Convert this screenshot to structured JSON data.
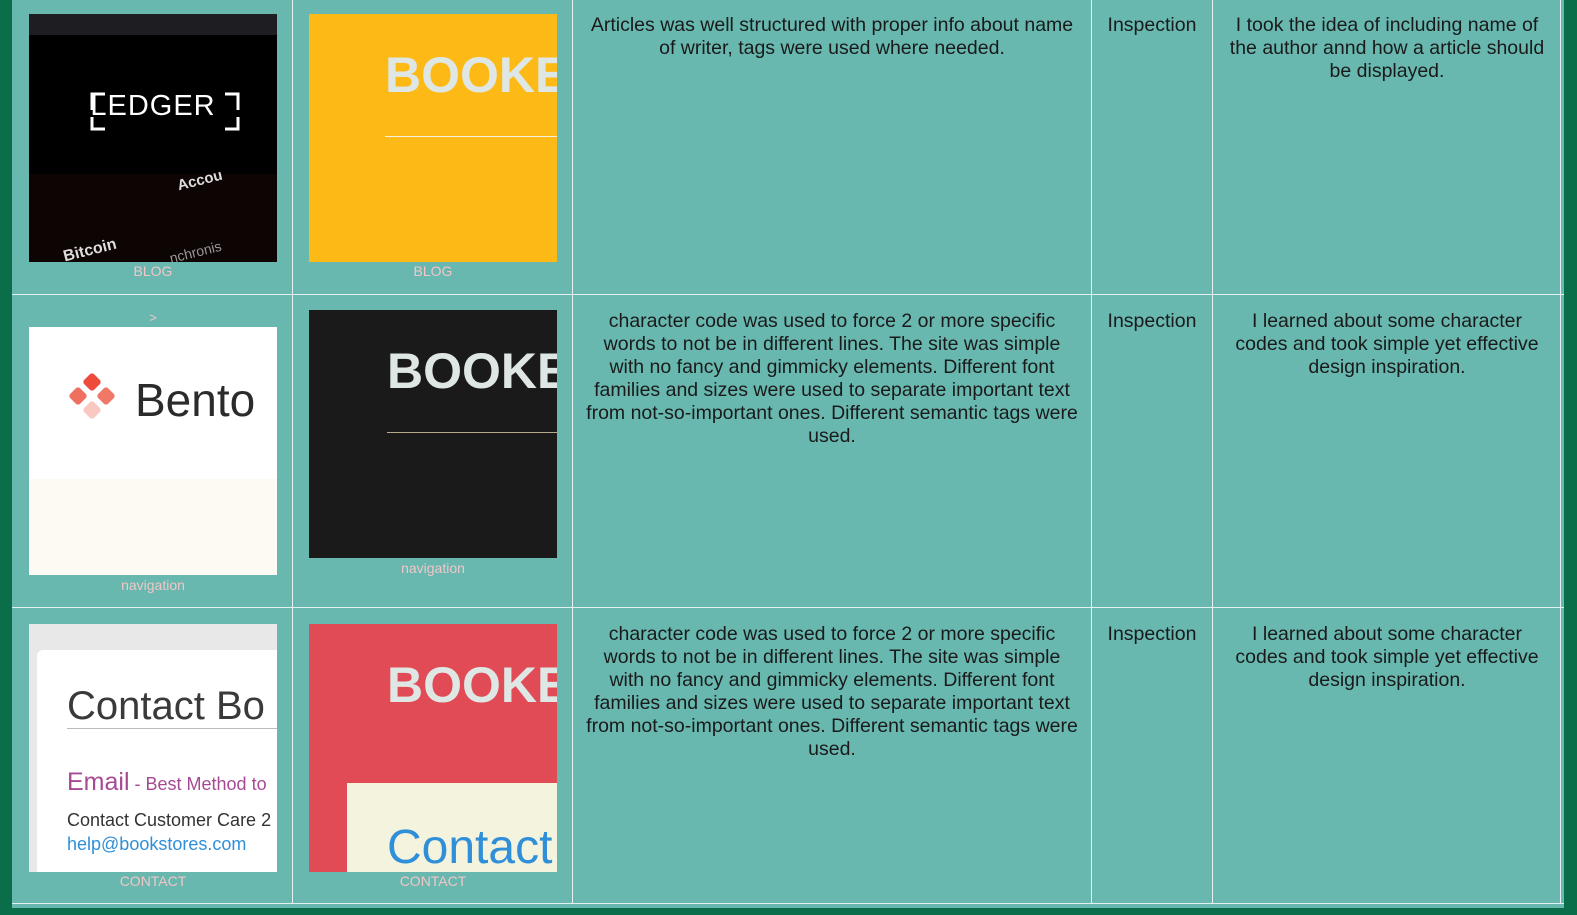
{
  "rows": [
    {
      "thumb1": {
        "brand": "LEDGER",
        "words": [
          "Accou",
          "Bitcoin",
          "nchronis"
        ],
        "caption": "BLOG"
      },
      "thumb2": {
        "title": "BOOKE",
        "caption": "BLOG"
      },
      "description": "Articles was well structured with proper info about name of writer, tags were used where needed.",
      "method": "Inspection",
      "learning": "I took the idea of including name of the author annd how a article should be displayed."
    },
    {
      "marker": ">",
      "thumb1": {
        "brand": "Bento",
        "caption": "navigation"
      },
      "thumb2": {
        "title": "BOOKE",
        "caption": "navigation"
      },
      "description": "character code was used to force 2 or more specific words to not be in different lines. The site was simple with no fancy and gimmicky elements. Different font families and sizes were used to separate important text from not-so-important ones. Different semantic tags were used.",
      "method": "Inspection",
      "learning": "I learned about some character codes and took simple yet effective design inspiration."
    },
    {
      "thumb1": {
        "heading": "Contact Bo",
        "email": "Email",
        "email_sub": " - Best Method to",
        "line": "Contact Customer Care 2",
        "address": "help@bookstores.com",
        "caption": "CONTACT"
      },
      "thumb2": {
        "title": "BOOKE",
        "contact": "Contact",
        "caption": "CONTACT"
      },
      "description": "character code was used to force 2 or more specific words to not be in different lines. The site was simple with no fancy and gimmicky elements. Different font families and sizes were used to separate important text from not-so-important ones. Different semantic tags were used.",
      "method": "Inspection",
      "learning": "I learned about some character codes and took simple yet effective design inspiration."
    }
  ]
}
